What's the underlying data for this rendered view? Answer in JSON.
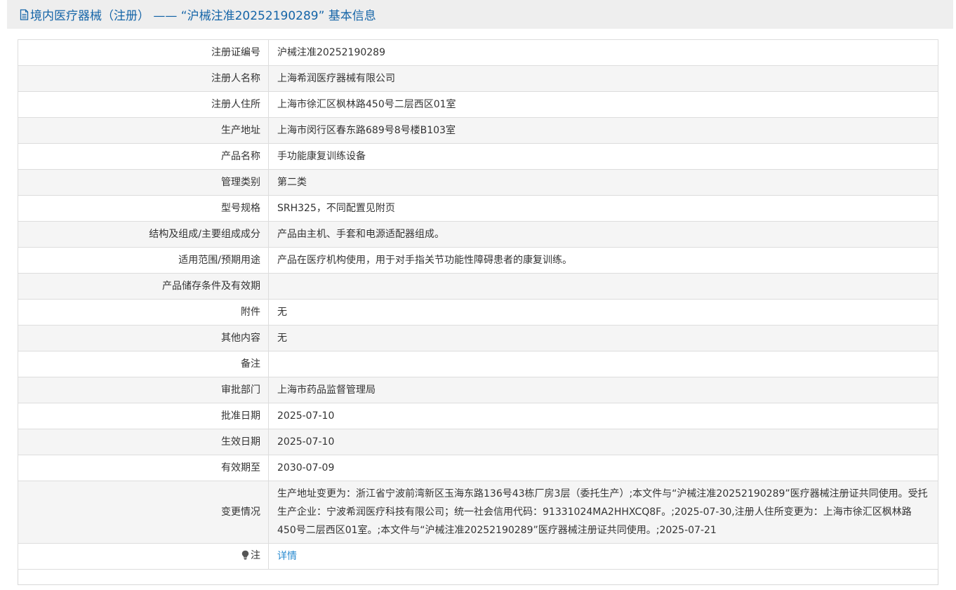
{
  "header": {
    "icon": "document-icon",
    "title": "境内医疗器械（注册） —— “沪械注准20252190289” 基本信息"
  },
  "rows": [
    {
      "label": "注册证编号",
      "value": "沪械注准20252190289"
    },
    {
      "label": "注册人名称",
      "value": "上海希润医疗器械有限公司"
    },
    {
      "label": "注册人住所",
      "value": "上海市徐汇区枫林路450号二层西区01室"
    },
    {
      "label": "生产地址",
      "value": "上海市闵行区春东路689号8号楼B103室"
    },
    {
      "label": "产品名称",
      "value": "手功能康复训练设备"
    },
    {
      "label": "管理类别",
      "value": "第二类"
    },
    {
      "label": "型号规格",
      "value": "SRH325，不同配置见附页"
    },
    {
      "label": "结构及组成/主要组成成分",
      "value": "产品由主机、手套和电源适配器组成。"
    },
    {
      "label": "适用范围/预期用途",
      "value": "产品在医疗机构使用，用于对手指关节功能性障碍患者的康复训练。"
    },
    {
      "label": "产品储存条件及有效期",
      "value": ""
    },
    {
      "label": "附件",
      "value": "无"
    },
    {
      "label": "其他内容",
      "value": "无"
    },
    {
      "label": "备注",
      "value": ""
    },
    {
      "label": "审批部门",
      "value": "上海市药品监督管理局"
    },
    {
      "label": "批准日期",
      "value": "2025-07-10"
    },
    {
      "label": "生效日期",
      "value": "2025-07-10"
    },
    {
      "label": "有效期至",
      "value": "2030-07-09"
    },
    {
      "label": "变更情况",
      "value": "生产地址变更为：浙江省宁波前湾新区玉海东路136号43栋厂房3层（委托生产）;本文件与“沪械注准20252190289”医疗器械注册证共同使用。受托生产企业：宁波希润医疗科技有限公司；统一社会信用代码：91331024MA2HHXCQ8F。;2025-07-30,注册人住所变更为：上海市徐汇区枫林路450号二层西区01室。;本文件与“沪械注准20252190289”医疗器械注册证共同使用。;2025-07-21"
    }
  ],
  "note": {
    "icon": "lightbulb-icon",
    "label": "注",
    "link_text": "详情"
  },
  "colors": {
    "title": "#1565a8",
    "link": "#2a8bd0",
    "header_bg": "#eeeeee",
    "alt_row_bg": "#f5f5f5",
    "border": "#dddddd"
  }
}
